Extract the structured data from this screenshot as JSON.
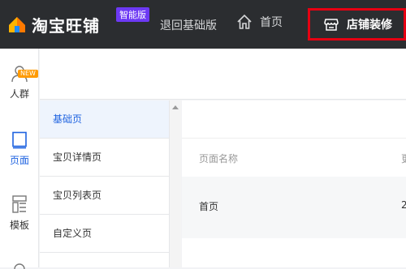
{
  "brand": {
    "name": "淘宝旺铺",
    "badge": "智能版"
  },
  "topbar": {
    "back_label": "退回基础版",
    "home_label": "首页",
    "store_decor_label": "店铺装修",
    "accent_color": "#e60012",
    "badge_color": "#6d39f4"
  },
  "leftbar": {
    "items": [
      {
        "label": "人群",
        "icon": "person-icon",
        "tag": "NEW"
      },
      {
        "label": "页面",
        "icon": "page-icon",
        "active": true
      },
      {
        "label": "模板",
        "icon": "template-icon"
      }
    ],
    "active_color": "#1f63e0"
  },
  "subnav": {
    "items": [
      {
        "label": "基础页",
        "active": true
      },
      {
        "label": "宝贝详情页"
      },
      {
        "label": "宝贝列表页"
      },
      {
        "label": "自定义页"
      }
    ]
  },
  "table": {
    "columns": [
      "页面名称",
      "更"
    ],
    "rows": [
      {
        "name": "首页",
        "more": "2"
      }
    ]
  }
}
